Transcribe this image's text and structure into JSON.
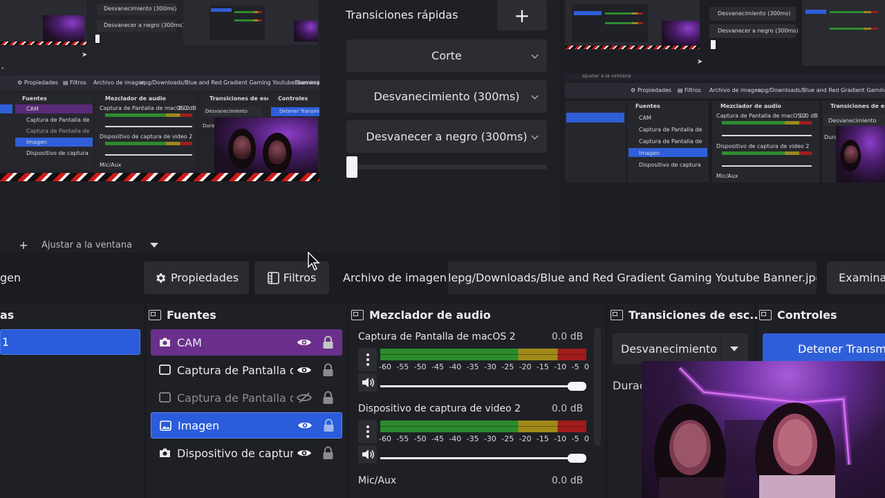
{
  "preview_left": {
    "mini_panels": {
      "dropdown_1": "Desvanecimiento (300ms)",
      "dropdown_2": "Desvanecer a negro (300ms)",
      "toolbar": {
        "properties": "Propiedades",
        "filters": "Filtros",
        "image_file": "Archivo de imagen",
        "path": "epg/Downloads/Blue and Red Gradient Gaming Youtube Banner.jpg",
        "browse": "Examinar"
      },
      "sources_title": "Fuentes",
      "sources": [
        "CAM",
        "Captura de Pantalla de",
        "Captura de Pantalla de",
        "Imagen",
        "Dispositivo de captura"
      ],
      "mixer_title": "Mezclador de audio",
      "mixer_tracks": [
        "Captura de Pantalla de macOS 2",
        "Dispositivo de captura de video 2",
        "Mic/Aux"
      ],
      "mixer_db": "0.0 dB",
      "transitions_title": "Transiciones de esc...",
      "controls_title": "Controles",
      "transition_value": "Desvanecimiento",
      "stop_label": "Detener Transmi",
      "duration_label": "Duraci"
    },
    "fit_label": "Ajustar a la ventana"
  },
  "quick_transitions": {
    "title": "Transiciones rápidas",
    "add_label": "+",
    "options": [
      "Corte",
      "Desvanecimiento (300ms)",
      "Desvanecer a negro (300ms)"
    ]
  },
  "preview_right": {
    "dropdown_1": "Desvanecimiento (300ms)",
    "dropdown_2": "Desvanecer a negro (300ms)",
    "fit_label": "Ajustar a la ventana",
    "properties": "Propiedades",
    "filters": "Filtros",
    "image_file": "Archivo de imagen",
    "path": "epg/Downloads/Blue and Red Gradient Gaming Youtube Banner.jpg",
    "sources_title": "Fuentes",
    "sources": [
      "CAM",
      "Captura de Pantalla de",
      "Captura de Pantalla de",
      "Imagen",
      "Dispositivo de captura"
    ],
    "mixer_title": "Mezclador de audio",
    "mixer_tracks": [
      "Captura de Pantalla de macOS 2",
      "Dispositivo de captura de video 2",
      "Mic/Aux"
    ],
    "mixer_db": "0.0 dB",
    "transitions_title": "Transiciones de esc",
    "transition_value": "Desvanecimiento",
    "duration_label": "Durac"
  },
  "properties_bar": {
    "left_fragment": "gen",
    "properties": "Propiedades",
    "filters": "Filtros",
    "image_file_label": "Archivo de imagen",
    "path": "lepg/Downloads/Blue and Red Gradient Gaming Youtube Banner.jpg",
    "browse": "Examinar"
  },
  "scenes": {
    "title_fragment": "as",
    "selected_item": "1"
  },
  "sources": {
    "title": "Fuentes",
    "items": [
      {
        "label": "CAM",
        "state": "highlighted-purple"
      },
      {
        "label": "Captura de Pantalla de macOS",
        "state": "normal"
      },
      {
        "label": "Captura de Pantalla de macOS",
        "state": "hidden"
      },
      {
        "label": "Imagen",
        "state": "selected"
      },
      {
        "label": "Dispositivo de captura de video",
        "state": "normal"
      }
    ]
  },
  "mixer": {
    "title": "Mezclador de audio",
    "ticks": [
      "-60",
      "-55",
      "-50",
      "-45",
      "-40",
      "-35",
      "-30",
      "-25",
      "-20",
      "-15",
      "-10",
      "-5",
      "0"
    ],
    "tracks": [
      {
        "name": "Captura de Pantalla de macOS 2",
        "db": "0.0 dB",
        "volume": 1.0
      },
      {
        "name": "Dispositivo de captura de video 2",
        "db": "0.0 dB",
        "volume": 1.0
      },
      {
        "name": "Mic/Aux",
        "db": "0.0 dB"
      }
    ]
  },
  "scene_transitions": {
    "title": "Transiciones de esc...",
    "value": "Desvanecimiento",
    "duration_label": "Duraci"
  },
  "controls": {
    "title": "Controles",
    "stop_stream": "Detener Transmisión"
  },
  "colors": {
    "accent_blue": "#2f5fd8",
    "selected_purple": "#6a2f8c",
    "hazard_red": "#d01414",
    "meter_green": "#2c8a2c",
    "meter_yellow": "#a08a18",
    "meter_red": "#a01c1c"
  },
  "icons": {
    "gear": "gear-icon",
    "filter": "filter-icon",
    "eye": "eye-icon",
    "eye_off": "eye-off-icon",
    "lock": "lock-icon",
    "camera": "camera-icon",
    "monitor": "monitor-icon",
    "image": "image-icon",
    "speaker": "speaker-icon",
    "dock": "dock-icon",
    "plus": "plus-icon",
    "cursor": "mouse-cursor-icon"
  }
}
